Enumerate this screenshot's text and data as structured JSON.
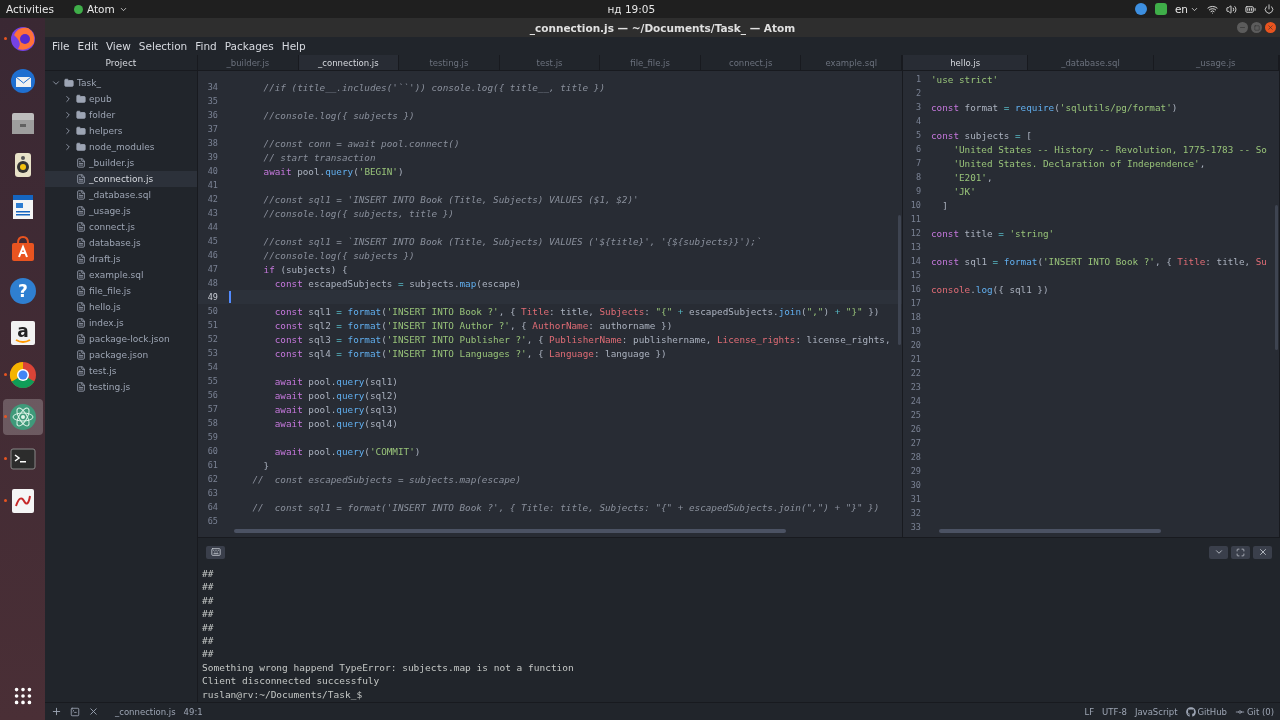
{
  "top_bar": {
    "activities": "Activities",
    "app_menu": "Atom",
    "clock": "нд 19:05",
    "language": "en"
  },
  "dock": [
    {
      "kind": "firefox",
      "running": true,
      "selected": false
    },
    {
      "kind": "mail",
      "running": false,
      "selected": false
    },
    {
      "kind": "files",
      "running": false,
      "selected": false
    },
    {
      "kind": "speaker",
      "running": false,
      "selected": false
    },
    {
      "kind": "writer",
      "running": false,
      "selected": false
    },
    {
      "kind": "store",
      "running": false,
      "selected": false
    },
    {
      "kind": "help",
      "label": "?",
      "running": false,
      "selected": false
    },
    {
      "kind": "amazon",
      "label": "a",
      "running": false,
      "selected": false
    },
    {
      "kind": "chrome",
      "running": true,
      "selected": false
    },
    {
      "kind": "atom",
      "running": true,
      "selected": true
    },
    {
      "kind": "terminal",
      "running": true,
      "selected": false
    },
    {
      "kind": "reader",
      "running": true,
      "selected": false
    },
    {
      "kind": "apps",
      "running": false,
      "selected": false
    }
  ],
  "window": {
    "title": "_connection.js — ~/Documents/Task_ — Atom"
  },
  "menu": [
    "File",
    "Edit",
    "View",
    "Selection",
    "Find",
    "Packages",
    "Help"
  ],
  "tree": {
    "header": "Project",
    "items": [
      {
        "name": "Task_",
        "kind": "folder",
        "expanded": true,
        "selected": false,
        "children": [
          {
            "name": "epub",
            "kind": "folder",
            "expanded": false,
            "selected": false
          },
          {
            "name": "folder",
            "kind": "folder",
            "expanded": false,
            "selected": false
          },
          {
            "name": "helpers",
            "kind": "folder",
            "expanded": false,
            "selected": false
          },
          {
            "name": "node_modules",
            "kind": "folder",
            "expanded": false,
            "selected": false
          },
          {
            "name": "_builder.js",
            "kind": "file",
            "selected": false
          },
          {
            "name": "_connection.js",
            "kind": "file",
            "selected": true
          },
          {
            "name": "_database.sql",
            "kind": "file",
            "selected": false
          },
          {
            "name": "_usage.js",
            "kind": "file",
            "selected": false
          },
          {
            "name": "connect.js",
            "kind": "file",
            "selected": false
          },
          {
            "name": "database.js",
            "kind": "file",
            "selected": false
          },
          {
            "name": "draft.js",
            "kind": "file",
            "selected": false
          },
          {
            "name": "example.sql",
            "kind": "file",
            "selected": false
          },
          {
            "name": "file_file.js",
            "kind": "file",
            "selected": false
          },
          {
            "name": "hello.js",
            "kind": "file",
            "selected": false
          },
          {
            "name": "index.js",
            "kind": "file",
            "selected": false
          },
          {
            "name": "package-lock.json",
            "kind": "file",
            "selected": false
          },
          {
            "name": "package.json",
            "kind": "file",
            "selected": false
          },
          {
            "name": "test.js",
            "kind": "file",
            "selected": false
          },
          {
            "name": "testing.js",
            "kind": "file",
            "selected": false
          }
        ]
      }
    ]
  },
  "panes": [
    {
      "tabs": [
        {
          "label": "_builder.js",
          "selected": false
        },
        {
          "label": "_connection.js",
          "selected": true
        },
        {
          "label": "testing.js",
          "selected": false
        },
        {
          "label": "test.js",
          "selected": false
        },
        {
          "label": "file_file.js",
          "selected": false
        },
        {
          "label": "connect.js",
          "selected": false
        },
        {
          "label": "example.sql",
          "selected": false
        }
      ],
      "lines": [
        {
          "num": "34",
          "current": false,
          "tokens": [
            {
              "kind": "cm",
              "text": "      //if (title__.includes('``')) console.log({ title__, title })"
            }
          ]
        },
        {
          "num": "35",
          "current": false
        },
        {
          "num": "36",
          "current": false,
          "tokens": [
            {
              "kind": "cm",
              "text": "      //console.log({ subjects })"
            }
          ]
        },
        {
          "num": "37",
          "current": false
        },
        {
          "num": "38",
          "current": false,
          "tokens": [
            {
              "kind": "cm",
              "text": "      //const conn = await pool.connect()"
            }
          ]
        },
        {
          "num": "39",
          "current": false,
          "tokens": [
            {
              "kind": "cm",
              "text": "      // start transaction"
            }
          ]
        },
        {
          "num": "40",
          "current": false,
          "tokens": [
            {
              "kind": "kw",
              "text": "      await"
            },
            {
              "kind": "tx",
              "text": " pool."
            },
            {
              "kind": "fn",
              "text": "query"
            },
            {
              "kind": "tx",
              "text": "("
            },
            {
              "kind": "str",
              "text": "'BEGIN'"
            },
            {
              "kind": "tx",
              "text": ")"
            }
          ]
        },
        {
          "num": "41",
          "current": false
        },
        {
          "num": "42",
          "current": false,
          "tokens": [
            {
              "kind": "cm",
              "text": "      //const sql1 = 'INSERT INTO Book (Title, Subjects) VALUES ($1, $2)'"
            }
          ]
        },
        {
          "num": "43",
          "current": false,
          "tokens": [
            {
              "kind": "cm",
              "text": "      //console.log({ subjects, title })"
            }
          ]
        },
        {
          "num": "44",
          "current": false
        },
        {
          "num": "45",
          "current": false,
          "tokens": [
            {
              "kind": "cm",
              "text": "      //const sql1 = `INSERT INTO Book (Title, Subjects) VALUES ('${title}', '{${subjects}}');`"
            }
          ]
        },
        {
          "num": "46",
          "current": false,
          "tokens": [
            {
              "kind": "cm",
              "text": "      //console.log({ subjects })"
            }
          ]
        },
        {
          "num": "47",
          "current": false,
          "tokens": [
            {
              "kind": "kw",
              "text": "      if"
            },
            {
              "kind": "tx",
              "text": " (subjects) {"
            }
          ]
        },
        {
          "num": "48",
          "current": false,
          "tokens": [
            {
              "kind": "kw",
              "text": "        const"
            },
            {
              "kind": "tx",
              "text": " escapedSubjects "
            },
            {
              "kind": "op",
              "text": "="
            },
            {
              "kind": "tx",
              "text": " subjects."
            },
            {
              "kind": "fn",
              "text": "map"
            },
            {
              "kind": "tx",
              "text": "(escape)"
            }
          ]
        },
        {
          "num": "49",
          "current": true
        },
        {
          "num": "50",
          "current": false,
          "tokens": [
            {
              "kind": "kw",
              "text": "        const"
            },
            {
              "kind": "tx",
              "text": " sql1 "
            },
            {
              "kind": "op",
              "text": "="
            },
            {
              "kind": "fn",
              "text": " format"
            },
            {
              "kind": "tx",
              "text": "("
            },
            {
              "kind": "str",
              "text": "'INSERT INTO Book ?'"
            },
            {
              "kind": "tx",
              "text": ", { "
            },
            {
              "kind": "prop",
              "text": "Title"
            },
            {
              "kind": "tx",
              "text": ": title, "
            },
            {
              "kind": "prop",
              "text": "Subjects"
            },
            {
              "kind": "tx",
              "text": ": "
            },
            {
              "kind": "str",
              "text": "\"{\""
            },
            {
              "kind": "op",
              "text": " +"
            },
            {
              "kind": "tx",
              "text": " escapedSubjects."
            },
            {
              "kind": "fn",
              "text": "join"
            },
            {
              "kind": "tx",
              "text": "("
            },
            {
              "kind": "str",
              "text": "\",\""
            },
            {
              "kind": "tx",
              "text": ") "
            },
            {
              "kind": "op",
              "text": "+"
            },
            {
              "kind": "str",
              "text": " \"}\""
            },
            {
              "kind": "tx",
              "text": " })"
            }
          ]
        },
        {
          "num": "51",
          "current": false,
          "tokens": [
            {
              "kind": "kw",
              "text": "        const"
            },
            {
              "kind": "tx",
              "text": " sql2 "
            },
            {
              "kind": "op",
              "text": "="
            },
            {
              "kind": "fn",
              "text": " format"
            },
            {
              "kind": "tx",
              "text": "("
            },
            {
              "kind": "str",
              "text": "'INSERT INTO Author ?'"
            },
            {
              "kind": "tx",
              "text": ", { "
            },
            {
              "kind": "prop",
              "text": "AuthorName"
            },
            {
              "kind": "tx",
              "text": ": authorname })"
            }
          ]
        },
        {
          "num": "52",
          "current": false,
          "tokens": [
            {
              "kind": "kw",
              "text": "        const"
            },
            {
              "kind": "tx",
              "text": " sql3 "
            },
            {
              "kind": "op",
              "text": "="
            },
            {
              "kind": "fn",
              "text": " format"
            },
            {
              "kind": "tx",
              "text": "("
            },
            {
              "kind": "str",
              "text": "'INSERT INTO Publisher ?'"
            },
            {
              "kind": "tx",
              "text": ", { "
            },
            {
              "kind": "prop",
              "text": "PublisherName"
            },
            {
              "kind": "tx",
              "text": ": publishername, "
            },
            {
              "kind": "prop",
              "text": "License_rights"
            },
            {
              "kind": "tx",
              "text": ": license_rights,"
            }
          ]
        },
        {
          "num": "53",
          "current": false,
          "tokens": [
            {
              "kind": "kw",
              "text": "        const"
            },
            {
              "kind": "tx",
              "text": " sql4 "
            },
            {
              "kind": "op",
              "text": "="
            },
            {
              "kind": "fn",
              "text": " format"
            },
            {
              "kind": "tx",
              "text": "("
            },
            {
              "kind": "str",
              "text": "'INSERT INTO Languages ?'"
            },
            {
              "kind": "tx",
              "text": ", { "
            },
            {
              "kind": "prop",
              "text": "Language"
            },
            {
              "kind": "tx",
              "text": ": language })"
            }
          ]
        },
        {
          "num": "54",
          "current": false
        },
        {
          "num": "55",
          "current": false,
          "tokens": [
            {
              "kind": "kw",
              "text": "        await"
            },
            {
              "kind": "tx",
              "text": " pool."
            },
            {
              "kind": "fn",
              "text": "query"
            },
            {
              "kind": "tx",
              "text": "(sql1)"
            }
          ]
        },
        {
          "num": "56",
          "current": false,
          "tokens": [
            {
              "kind": "kw",
              "text": "        await"
            },
            {
              "kind": "tx",
              "text": " pool."
            },
            {
              "kind": "fn",
              "text": "query"
            },
            {
              "kind": "tx",
              "text": "(sql2)"
            }
          ]
        },
        {
          "num": "57",
          "current": false,
          "tokens": [
            {
              "kind": "kw",
              "text": "        await"
            },
            {
              "kind": "tx",
              "text": " pool."
            },
            {
              "kind": "fn",
              "text": "query"
            },
            {
              "kind": "tx",
              "text": "(sql3)"
            }
          ]
        },
        {
          "num": "58",
          "current": false,
          "tokens": [
            {
              "kind": "kw",
              "text": "        await"
            },
            {
              "kind": "tx",
              "text": " pool."
            },
            {
              "kind": "fn",
              "text": "query"
            },
            {
              "kind": "tx",
              "text": "(sql4)"
            }
          ]
        },
        {
          "num": "59",
          "current": false
        },
        {
          "num": "60",
          "current": false,
          "tokens": [
            {
              "kind": "kw",
              "text": "        await"
            },
            {
              "kind": "tx",
              "text": " pool."
            },
            {
              "kind": "fn",
              "text": "query"
            },
            {
              "kind": "tx",
              "text": "("
            },
            {
              "kind": "str",
              "text": "'COMMIT'"
            },
            {
              "kind": "tx",
              "text": ")"
            }
          ]
        },
        {
          "num": "61",
          "current": false,
          "tokens": [
            {
              "kind": "tx",
              "text": "      }"
            }
          ]
        },
        {
          "num": "62",
          "current": false,
          "tokens": [
            {
              "kind": "cm",
              "text": "    //  const escapedSubjects = subjects.map(escape)"
            }
          ]
        },
        {
          "num": "63",
          "current": false
        },
        {
          "num": "64",
          "current": false,
          "tokens": [
            {
              "kind": "cm",
              "text": "    //  const sql1 = format('INSERT INTO Book ?', { Title: title, Subjects: \"{\" + escapedSubjects.join(\",\") + \"}\" })"
            }
          ]
        },
        {
          "num": "65",
          "current": false
        }
      ]
    },
    {
      "tabs": [
        {
          "label": "hello.js",
          "selected": true
        },
        {
          "label": "_database.sql",
          "selected": false
        },
        {
          "label": "_usage.js",
          "selected": false
        }
      ],
      "lines": [
        {
          "num": "1",
          "current": false,
          "tokens": [
            {
              "kind": "str",
              "text": "'use strict'"
            }
          ]
        },
        {
          "num": "2",
          "current": false
        },
        {
          "num": "3",
          "current": false,
          "tokens": [
            {
              "kind": "kw",
              "text": "const"
            },
            {
              "kind": "tx",
              "text": " format "
            },
            {
              "kind": "op",
              "text": "="
            },
            {
              "kind": "fn",
              "text": " require"
            },
            {
              "kind": "tx",
              "text": "("
            },
            {
              "kind": "str",
              "text": "'sqlutils/pg/format'"
            },
            {
              "kind": "tx",
              "text": ")"
            }
          ]
        },
        {
          "num": "4",
          "current": false
        },
        {
          "num": "5",
          "current": false,
          "tokens": [
            {
              "kind": "kw",
              "text": "const"
            },
            {
              "kind": "tx",
              "text": " subjects "
            },
            {
              "kind": "op",
              "text": "="
            },
            {
              "kind": "tx",
              "text": " ["
            }
          ]
        },
        {
          "num": "6",
          "current": false,
          "tokens": [
            {
              "kind": "str",
              "text": "    'United States -- History -- Revolution, 1775-1783 -- So"
            }
          ]
        },
        {
          "num": "7",
          "current": false,
          "tokens": [
            {
              "kind": "str",
              "text": "    'United States. Declaration of Independence'"
            },
            {
              "kind": "tx",
              "text": ","
            }
          ]
        },
        {
          "num": "8",
          "current": false,
          "tokens": [
            {
              "kind": "str",
              "text": "    'E201'"
            },
            {
              "kind": "tx",
              "text": ","
            }
          ]
        },
        {
          "num": "9",
          "current": false,
          "tokens": [
            {
              "kind": "str",
              "text": "    'JK'"
            }
          ]
        },
        {
          "num": "10",
          "current": false,
          "tokens": [
            {
              "kind": "tx",
              "text": "  ]"
            }
          ]
        },
        {
          "num": "11",
          "current": false
        },
        {
          "num": "12",
          "current": false,
          "tokens": [
            {
              "kind": "kw",
              "text": "const"
            },
            {
              "kind": "tx",
              "text": " title "
            },
            {
              "kind": "op",
              "text": "="
            },
            {
              "kind": "str",
              "text": " 'string'"
            }
          ]
        },
        {
          "num": "13",
          "current": false
        },
        {
          "num": "14",
          "current": false,
          "tokens": [
            {
              "kind": "kw",
              "text": "const"
            },
            {
              "kind": "tx",
              "text": " sql1 "
            },
            {
              "kind": "op",
              "text": "="
            },
            {
              "kind": "fn",
              "text": " format"
            },
            {
              "kind": "tx",
              "text": "("
            },
            {
              "kind": "str",
              "text": "'INSERT INTO Book ?'"
            },
            {
              "kind": "tx",
              "text": ", { "
            },
            {
              "kind": "prop",
              "text": "Title"
            },
            {
              "kind": "tx",
              "text": ": title, "
            },
            {
              "kind": "prop",
              "text": "Su"
            }
          ]
        },
        {
          "num": "15",
          "current": false
        },
        {
          "num": "16",
          "current": false,
          "tokens": [
            {
              "kind": "prop",
              "text": "console"
            },
            {
              "kind": "tx",
              "text": "."
            },
            {
              "kind": "fn",
              "text": "log"
            },
            {
              "kind": "tx",
              "text": "({ sql1 })"
            }
          ]
        },
        {
          "num": "17",
          "current": false
        },
        {
          "num": "18",
          "current": false
        },
        {
          "num": "19",
          "current": false
        },
        {
          "num": "20",
          "current": false
        },
        {
          "num": "21",
          "current": false
        },
        {
          "num": "22",
          "current": false
        },
        {
          "num": "23",
          "current": false
        },
        {
          "num": "24",
          "current": false
        },
        {
          "num": "25",
          "current": false
        },
        {
          "num": "26",
          "current": false
        },
        {
          "num": "27",
          "current": false
        },
        {
          "num": "28",
          "current": false
        },
        {
          "num": "29",
          "current": false
        },
        {
          "num": "30",
          "current": false
        },
        {
          "num": "31",
          "current": false
        },
        {
          "num": "32",
          "current": false
        },
        {
          "num": "33",
          "current": false
        }
      ]
    }
  ],
  "terminal": {
    "lines": [
      "##",
      "##",
      "##",
      "##",
      "##",
      "##",
      "##",
      "Something wrong happend TypeError: subjects.map is not a function",
      "Client disconnected successfuly",
      "ruslan@rv:~/Documents/Task_$"
    ]
  },
  "status_bar": {
    "file": "_connection.js",
    "cursor": "49:1",
    "line_ending": "LF",
    "encoding": "UTF-8",
    "grammar": "JavaScript",
    "github": "GitHub",
    "git": "Git (0)"
  }
}
